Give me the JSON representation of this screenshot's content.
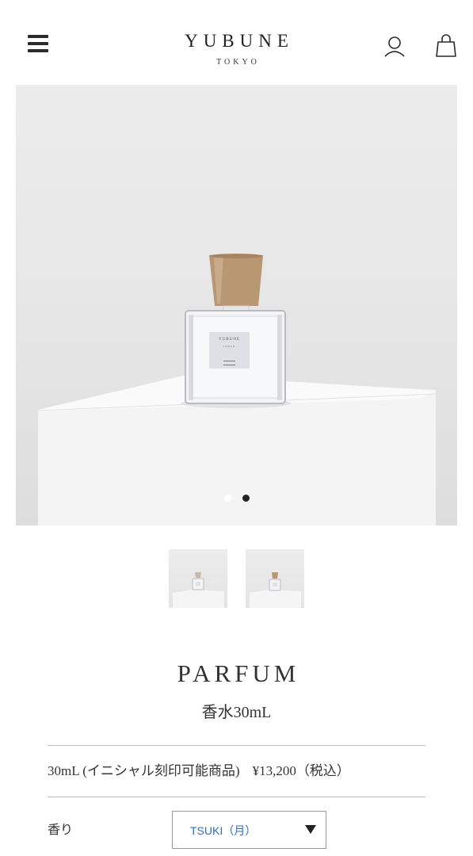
{
  "header": {
    "brand": "YUBUNE",
    "brand_sub": "TOKYO",
    "icons": [
      "menu-icon",
      "user-icon",
      "shopping-bag-icon"
    ]
  },
  "gallery": {
    "slide_count": 2,
    "active_slide": 2,
    "bottle_label_brand": "YUBUNE",
    "bottle_label_city": "TOKYO",
    "thumbnails": 2
  },
  "product": {
    "title": "PARFUM",
    "subtitle": "香水30mL",
    "variant": "30mL (イニシャル刻印可能商品)",
    "price": "¥13,200（税込）"
  },
  "options": {
    "scent_label": "香り",
    "scent_value": "TSUKI（月）"
  },
  "colors": {
    "text": "#333333",
    "select_text": "#2f6fb7",
    "divider": "#bdbdbd"
  }
}
